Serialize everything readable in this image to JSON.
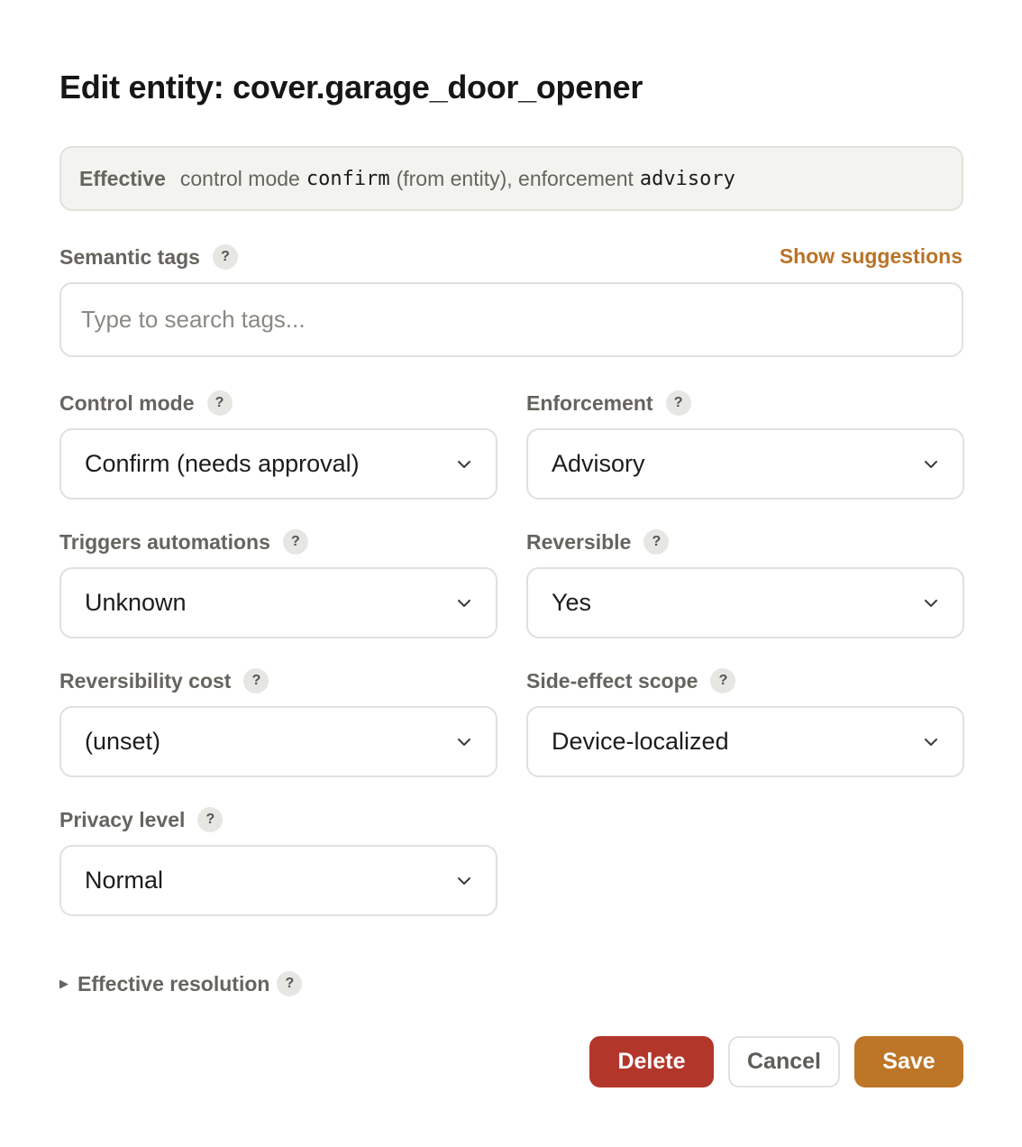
{
  "dialog": {
    "title": "Edit entity: cover.garage_door_opener"
  },
  "effective": {
    "label": "Effective",
    "text_control": "control mode",
    "control_value": "confirm",
    "text_from": "(from entity), enforcement",
    "enforcement_value": "advisory"
  },
  "tags": {
    "label": "Semantic tags",
    "suggestions_label": "Show suggestions",
    "placeholder": "Type to search tags..."
  },
  "fields": {
    "control_mode": {
      "label": "Control mode",
      "value": "Confirm (needs approval)"
    },
    "enforcement": {
      "label": "Enforcement",
      "value": "Advisory"
    },
    "triggers_automations": {
      "label": "Triggers automations",
      "value": "Unknown"
    },
    "reversible": {
      "label": "Reversible",
      "value": "Yes"
    },
    "reversibility_cost": {
      "label": "Reversibility cost",
      "value": "(unset)"
    },
    "side_effect_scope": {
      "label": "Side-effect scope",
      "value": "Device-localized"
    },
    "privacy_level": {
      "label": "Privacy level",
      "value": "Normal"
    }
  },
  "help_glyph": "?",
  "resolution": {
    "toggle_glyph": "▶",
    "label": "Effective resolution"
  },
  "actions": {
    "delete_label": "Delete",
    "cancel_label": "Cancel",
    "save_label": "Save"
  },
  "colors": {
    "accent": "#bd7627",
    "danger": "#b3362b",
    "link": "#b97326"
  },
  "icons": {
    "help": "question-circle-icon",
    "dropdown": "chevron-down-icon",
    "disclosure": "triangle-right-icon"
  }
}
